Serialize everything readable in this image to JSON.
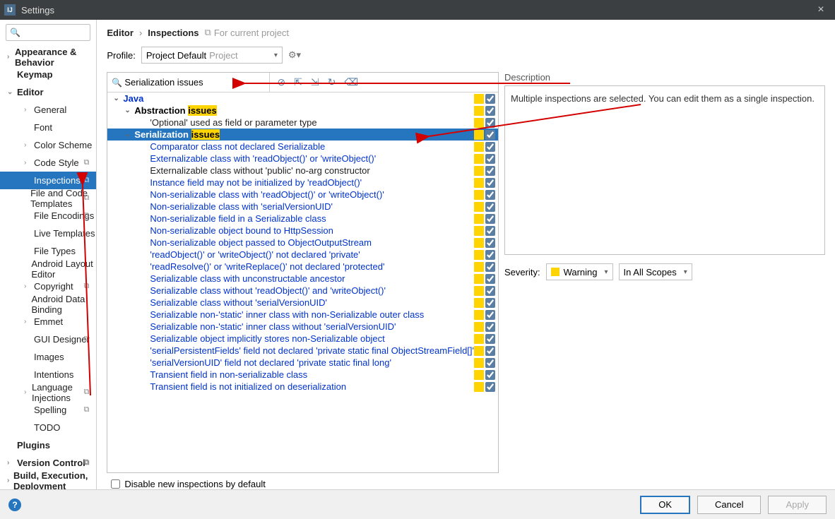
{
  "window": {
    "title": "Settings"
  },
  "sidebar": {
    "search_placeholder": "",
    "items": [
      {
        "label": "Appearance & Behavior",
        "bold": true,
        "arrow": "›"
      },
      {
        "label": "Keymap",
        "bold": true,
        "arrow": ""
      },
      {
        "label": "Editor",
        "bold": true,
        "arrow": "⌄"
      },
      {
        "label": "General",
        "child": true,
        "arrow": "›"
      },
      {
        "label": "Font",
        "child": true
      },
      {
        "label": "Color Scheme",
        "child": true,
        "arrow": "›"
      },
      {
        "label": "Code Style",
        "child": true,
        "arrow": "›",
        "copy": true
      },
      {
        "label": "Inspections",
        "child": true,
        "selected": true,
        "copy": true
      },
      {
        "label": "File and Code Templates",
        "child": true,
        "copy": true
      },
      {
        "label": "File Encodings",
        "child": true,
        "copy": true
      },
      {
        "label": "Live Templates",
        "child": true
      },
      {
        "label": "File Types",
        "child": true
      },
      {
        "label": "Android Layout Editor",
        "child": true
      },
      {
        "label": "Copyright",
        "child": true,
        "arrow": "›",
        "copy": true
      },
      {
        "label": "Android Data Binding",
        "child": true
      },
      {
        "label": "Emmet",
        "child": true,
        "arrow": "›"
      },
      {
        "label": "GUI Designer",
        "child": true,
        "copy": true
      },
      {
        "label": "Images",
        "child": true
      },
      {
        "label": "Intentions",
        "child": true
      },
      {
        "label": "Language Injections",
        "child": true,
        "arrow": "›",
        "copy": true
      },
      {
        "label": "Spelling",
        "child": true,
        "copy": true
      },
      {
        "label": "TODO",
        "child": true
      },
      {
        "label": "Plugins",
        "bold": true
      },
      {
        "label": "Version Control",
        "bold": true,
        "arrow": "›",
        "copy": true
      },
      {
        "label": "Build, Execution, Deployment",
        "bold": true,
        "arrow": "›"
      }
    ]
  },
  "breadcrumb": {
    "a": "Editor",
    "b": "Inspections",
    "proj": "For current project"
  },
  "profile": {
    "label": "Profile:",
    "value": "Project Default",
    "gray": "Project"
  },
  "insp_search": "Serialization issues",
  "tree": {
    "java": "Java",
    "abstraction": {
      "pre": "Abstraction ",
      "hl": "issues"
    },
    "abstraction_item": "'Optional' used as field or parameter type",
    "serialization": {
      "pre": "Serialization ",
      "hl": "issues"
    },
    "items": [
      "Comparator class not declared Serializable",
      "Externalizable class with 'readObject()' or 'writeObject()'",
      "Externalizable class without 'public' no-arg constructor",
      "Instance field may not be initialized by 'readObject()'",
      "Non-serializable class with 'readObject()' or 'writeObject()'",
      "Non-serializable class with 'serialVersionUID'",
      "Non-serializable field in a Serializable class",
      "Non-serializable object bound to HttpSession",
      "Non-serializable object passed to ObjectOutputStream",
      "'readObject()' or 'writeObject()' not declared 'private'",
      "'readResolve()' or 'writeReplace()' not declared 'protected'",
      "Serializable class with unconstructable ancestor",
      "Serializable class without 'readObject()' and 'writeObject()'",
      "Serializable class without 'serialVersionUID'",
      "Serializable non-'static' inner class with non-Serializable outer class",
      "Serializable non-'static' inner class without 'serialVersionUID'",
      "Serializable object implicitly stores non-Serializable object",
      "'serialPersistentFields' field not declared 'private static final ObjectStreamField[]'",
      "'serialVersionUID' field not declared 'private static final long'",
      "Transient field in non-serializable class",
      "Transient field is not initialized on deserialization"
    ],
    "black_index": 2
  },
  "desc": {
    "label": "Description",
    "text": "Multiple inspections are selected. You can edit them as a single inspection."
  },
  "severity": {
    "label": "Severity:",
    "value": "Warning",
    "scope": "In All Scopes"
  },
  "disable": "Disable new inspections by default",
  "footer": {
    "ok": "OK",
    "cancel": "Cancel",
    "apply": "Apply"
  }
}
